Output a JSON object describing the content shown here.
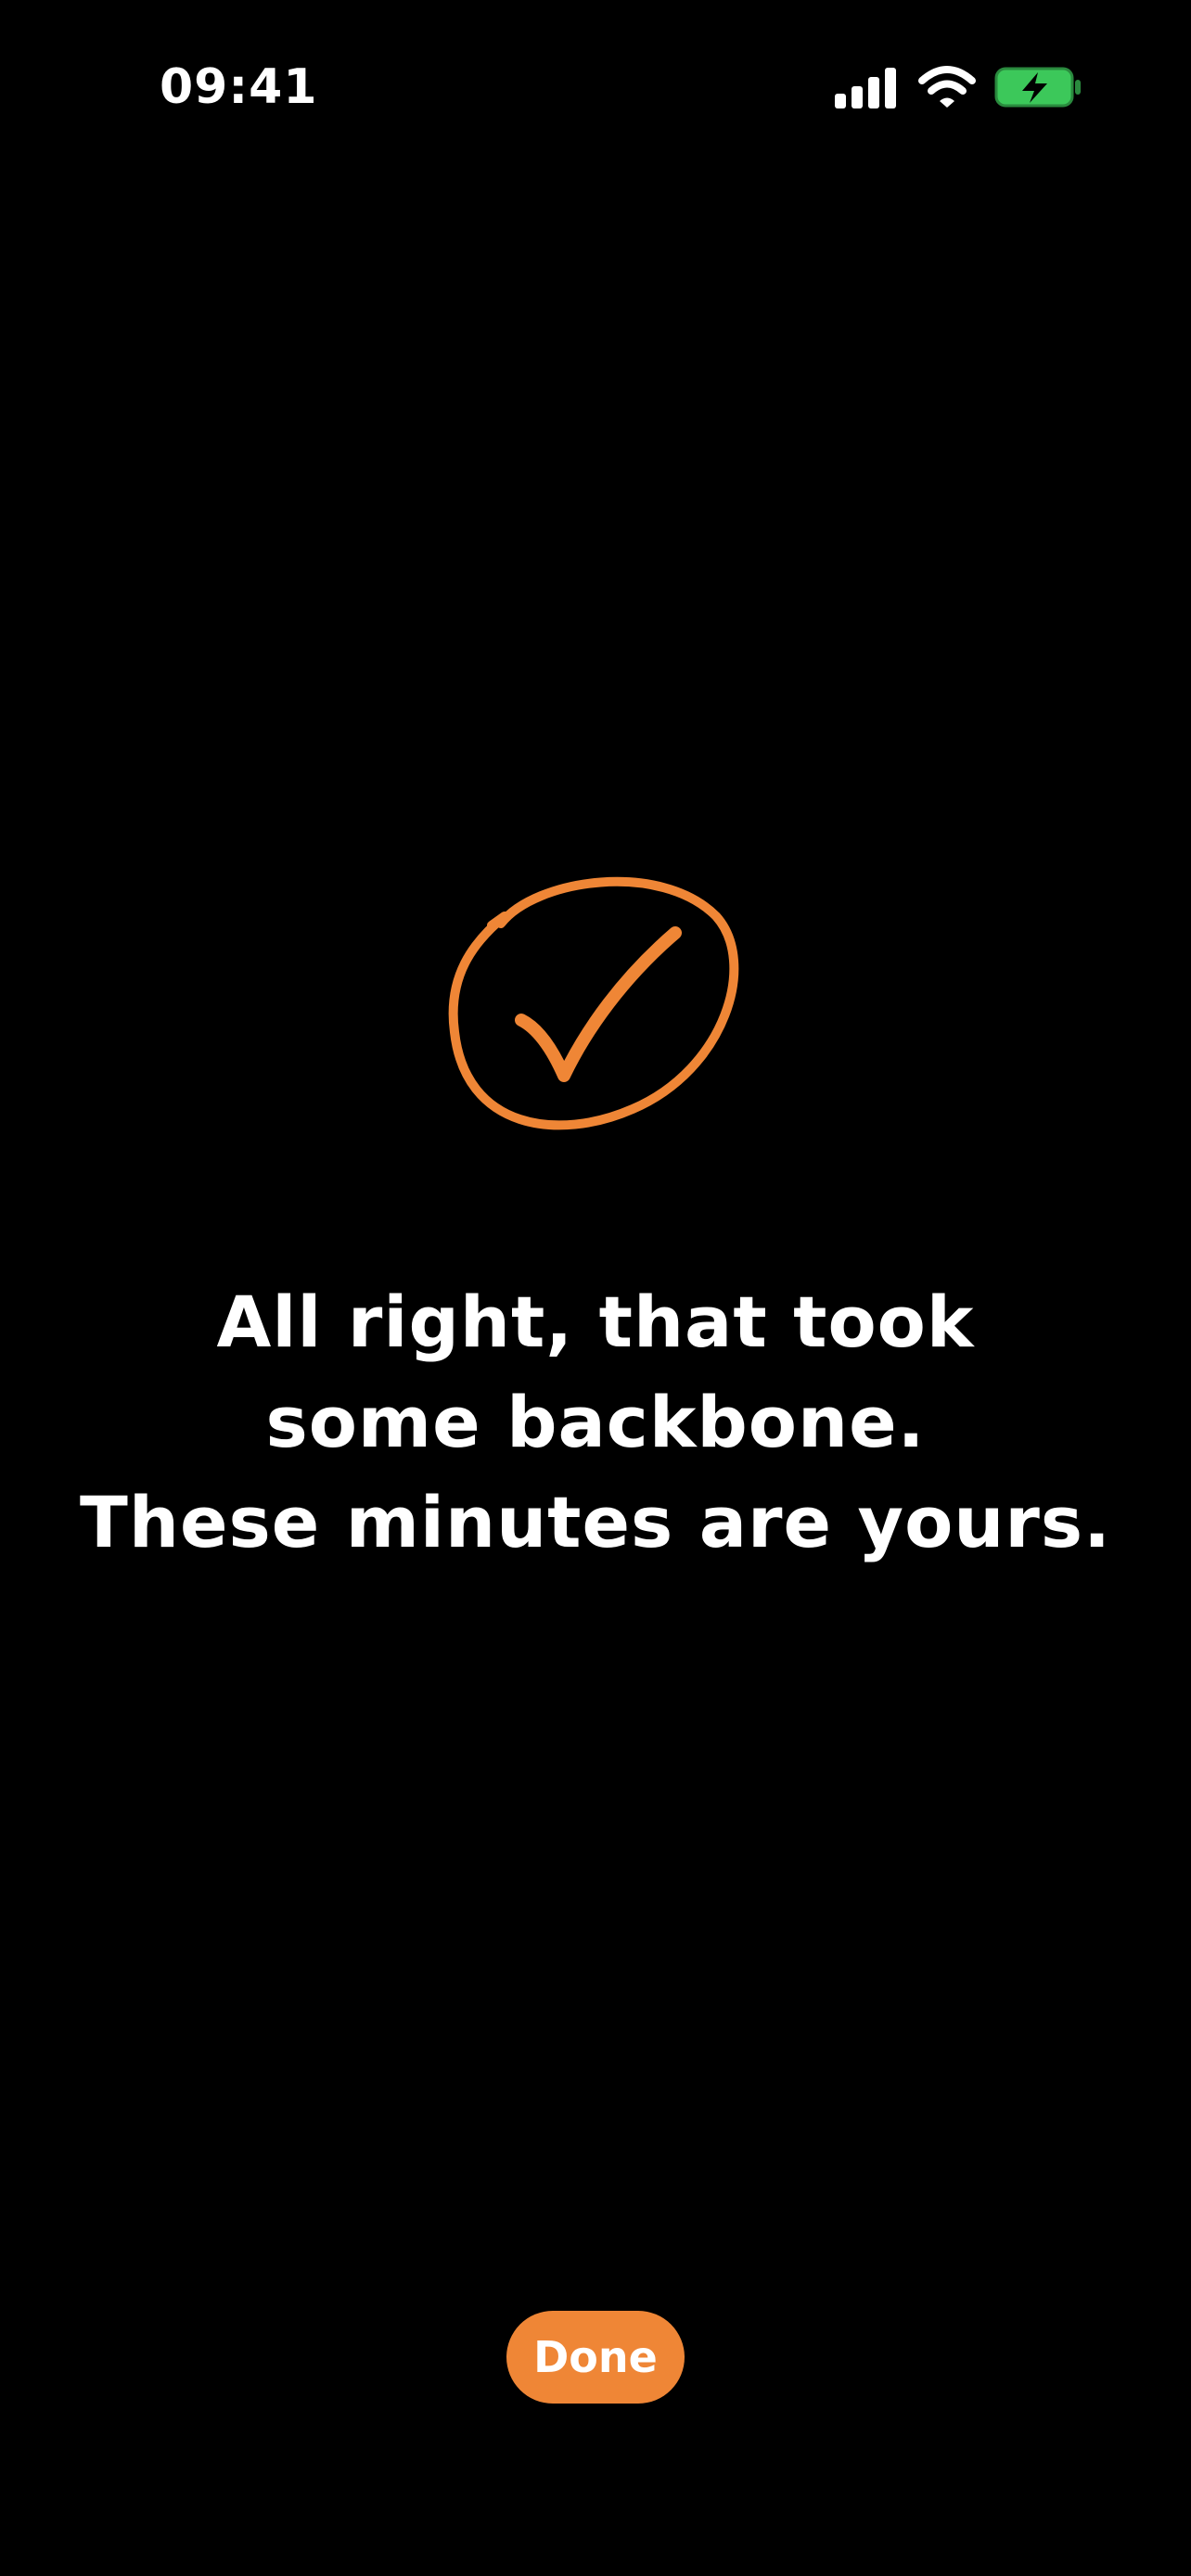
{
  "status_bar": {
    "time": "09:41",
    "icons": [
      "signal-icon",
      "wifi-icon",
      "battery-charging-icon"
    ]
  },
  "main": {
    "icon": "hand-drawn-checkmark-circle-icon",
    "message_lines": [
      "All right, that took",
      "some backbone.",
      "These minutes are yours."
    ]
  },
  "done_button": {
    "label": "Done"
  },
  "colors": {
    "background": "#000000",
    "accent": "#ef8636",
    "battery": "#3cc85a",
    "text": "#ffffff"
  }
}
